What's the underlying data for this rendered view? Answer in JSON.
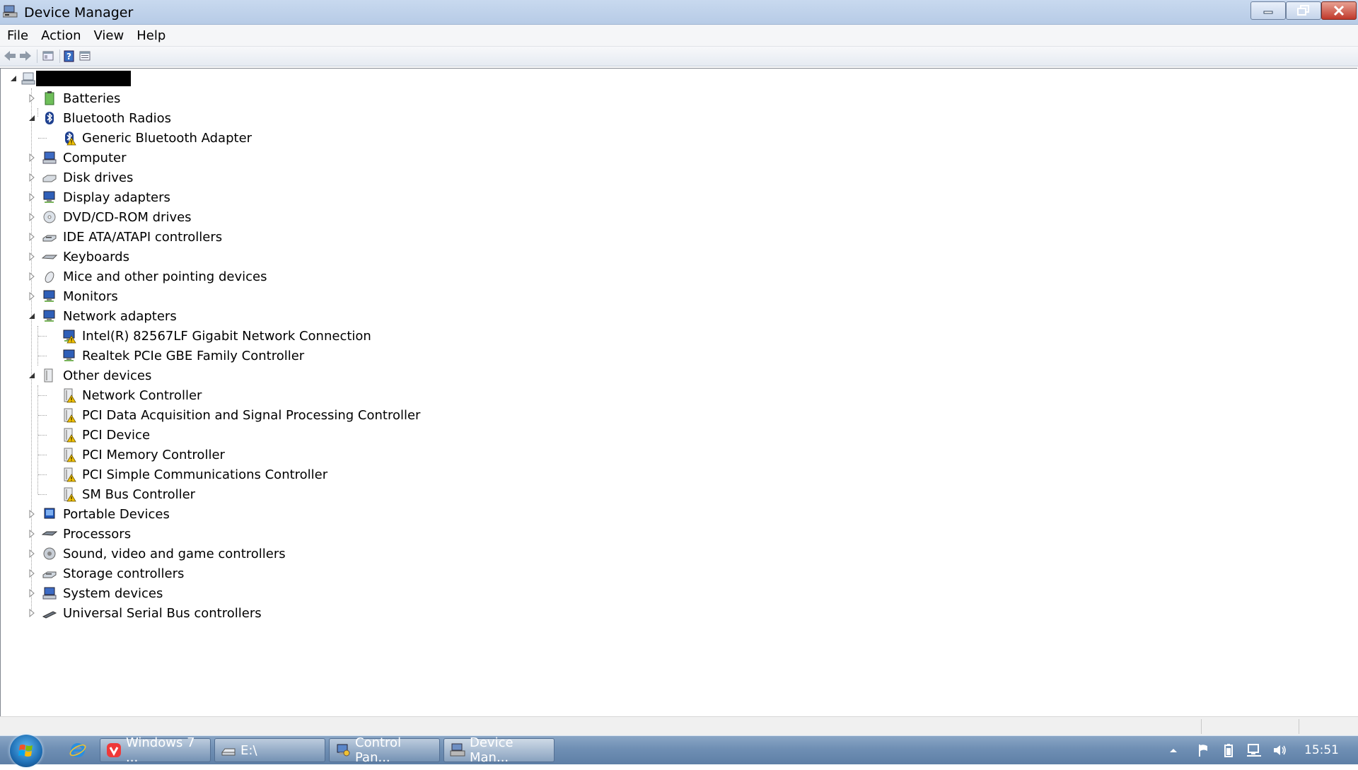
{
  "window": {
    "title": "Device Manager",
    "icon": "device-manager-icon",
    "controls": [
      "minimize",
      "restore",
      "close"
    ]
  },
  "menu": [
    "File",
    "Action",
    "View",
    "Help"
  ],
  "toolbar": {
    "buttons": [
      "back-arrow-icon",
      "forward-arrow-icon",
      "show-hide-console-tree-icon",
      "help-icon",
      "properties-icon"
    ]
  },
  "tree": {
    "root": {
      "label": "",
      "redacted": true,
      "icon": "computer-icon"
    },
    "categories": [
      {
        "label": "Batteries",
        "icon": "battery-icon",
        "expanded": false
      },
      {
        "label": "Bluetooth Radios",
        "icon": "bluetooth-icon",
        "expanded": true,
        "children": [
          {
            "label": "Generic Bluetooth Adapter",
            "icon": "bluetooth-warning-icon"
          }
        ]
      },
      {
        "label": "Computer",
        "icon": "computer-icon",
        "expanded": false
      },
      {
        "label": "Disk drives",
        "icon": "disk-drive-icon",
        "expanded": false
      },
      {
        "label": "Display adapters",
        "icon": "display-adapter-icon",
        "expanded": false
      },
      {
        "label": "DVD/CD-ROM drives",
        "icon": "dvd-drive-icon",
        "expanded": false
      },
      {
        "label": "IDE ATA/ATAPI controllers",
        "icon": "ide-controller-icon",
        "expanded": false
      },
      {
        "label": "Keyboards",
        "icon": "keyboard-icon",
        "expanded": false
      },
      {
        "label": "Mice and other pointing devices",
        "icon": "mouse-icon",
        "expanded": false
      },
      {
        "label": "Monitors",
        "icon": "monitor-icon",
        "expanded": false
      },
      {
        "label": "Network adapters",
        "icon": "network-adapter-icon",
        "expanded": true,
        "children": [
          {
            "label": "Intel(R) 82567LF Gigabit Network Connection",
            "icon": "network-adapter-warning-icon"
          },
          {
            "label": "Realtek PCIe GBE Family Controller",
            "icon": "network-adapter-icon"
          }
        ]
      },
      {
        "label": "Other devices",
        "icon": "unknown-device-icon",
        "expanded": true,
        "children": [
          {
            "label": "Network Controller",
            "icon": "unknown-device-warning-icon"
          },
          {
            "label": "PCI Data Acquisition and Signal Processing Controller",
            "icon": "unknown-device-warning-icon"
          },
          {
            "label": "PCI Device",
            "icon": "unknown-device-warning-icon"
          },
          {
            "label": "PCI Memory Controller",
            "icon": "unknown-device-warning-icon"
          },
          {
            "label": "PCI Simple Communications Controller",
            "icon": "unknown-device-warning-icon"
          },
          {
            "label": "SM Bus Controller",
            "icon": "unknown-device-warning-icon"
          }
        ]
      },
      {
        "label": "Portable Devices",
        "icon": "portable-device-icon",
        "expanded": false
      },
      {
        "label": "Processors",
        "icon": "processor-icon",
        "expanded": false
      },
      {
        "label": "Sound, video and game controllers",
        "icon": "sound-icon",
        "expanded": false
      },
      {
        "label": "Storage controllers",
        "icon": "storage-controller-icon",
        "expanded": false
      },
      {
        "label": "System devices",
        "icon": "system-device-icon",
        "expanded": false
      },
      {
        "label": "Universal Serial Bus controllers",
        "icon": "usb-icon",
        "expanded": false
      }
    ]
  },
  "taskbar": {
    "items": [
      {
        "label": "Windows 7 ...",
        "icon": "vivaldi-browser-icon"
      },
      {
        "label": "E:\\",
        "icon": "drive-icon"
      },
      {
        "label": "Control Pan...",
        "icon": "control-panel-icon"
      },
      {
        "label": "Device Man...",
        "icon": "device-manager-icon"
      }
    ],
    "pinned": [
      "internet-explorer-icon"
    ],
    "tray": [
      "show-hidden-icons-arrow",
      "action-center-flag-icon",
      "battery-icon",
      "network-icon",
      "volume-icon"
    ],
    "clock": "15:51"
  },
  "colors": {
    "titlebar": "#c8d9ef",
    "taskbar": "#6f8fb4",
    "warning": "#f2c200",
    "close_button": "#c0392b"
  }
}
